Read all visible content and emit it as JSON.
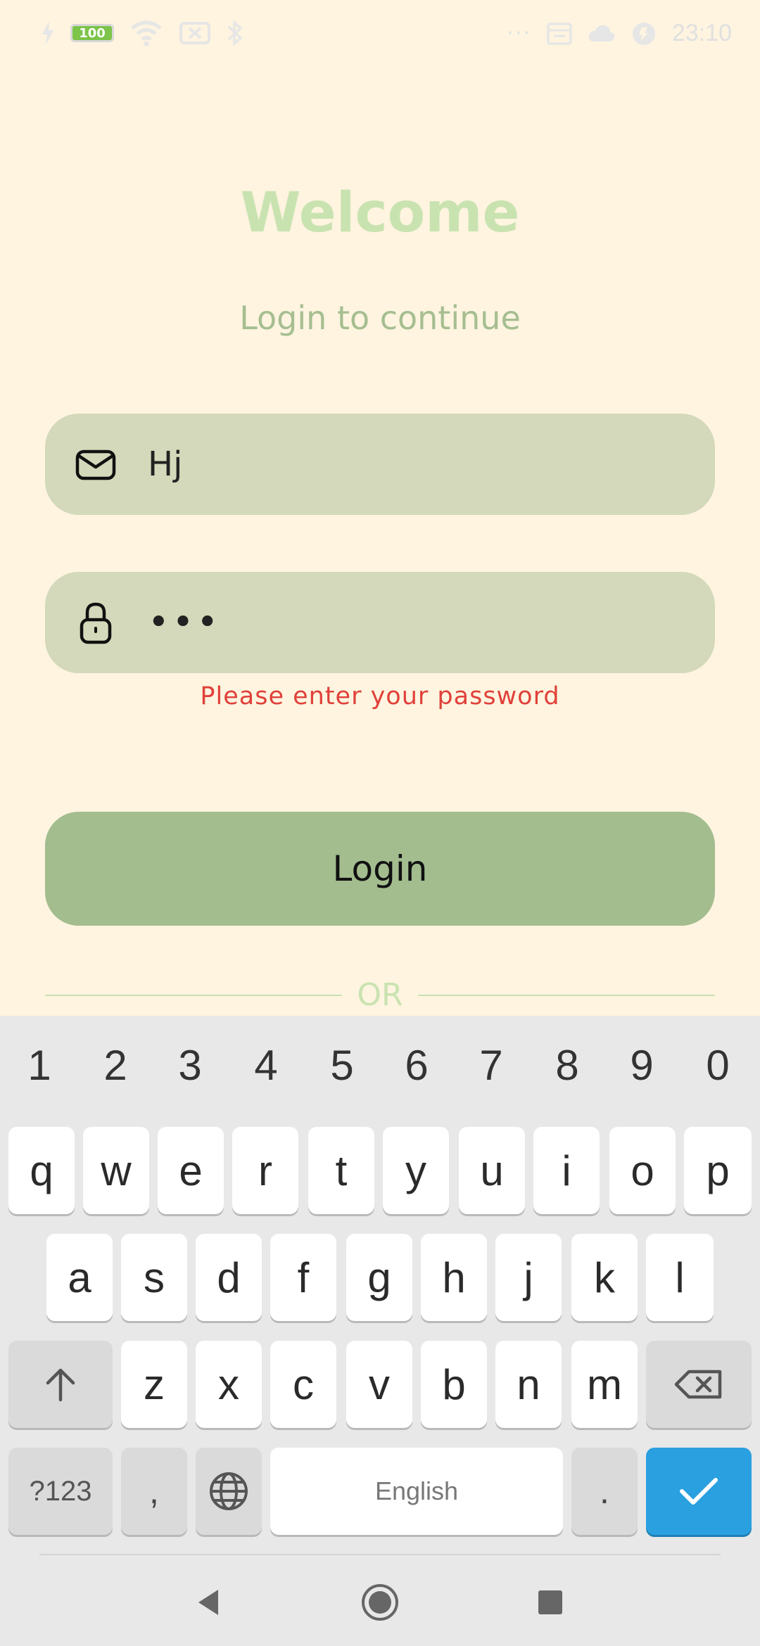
{
  "status_bar": {
    "battery": "100",
    "time": "23:10",
    "more_dots": "···"
  },
  "login": {
    "title": "Welcome",
    "subtitle": "Login to continue",
    "email_value": "Hj",
    "password_value": "•••",
    "error": "Please enter your password",
    "login_label": "Login",
    "or_label": "OR"
  },
  "keyboard": {
    "numbers": [
      "1",
      "2",
      "3",
      "4",
      "5",
      "6",
      "7",
      "8",
      "9",
      "0"
    ],
    "row1": [
      "q",
      "w",
      "e",
      "r",
      "t",
      "y",
      "u",
      "i",
      "o",
      "p"
    ],
    "row2": [
      "a",
      "s",
      "d",
      "f",
      "g",
      "h",
      "j",
      "k",
      "l"
    ],
    "row3": [
      "z",
      "x",
      "c",
      "v",
      "b",
      "n",
      "m"
    ],
    "sym_label": "?123",
    "comma": ",",
    "space_label": "English",
    "period": "."
  },
  "colors": {
    "background": "#fef4e0",
    "title": "#c9e3b0",
    "field": "#d3d9ba",
    "button": "#a3bd8f",
    "error": "#e0413a",
    "enter": "#2aa0e0"
  }
}
